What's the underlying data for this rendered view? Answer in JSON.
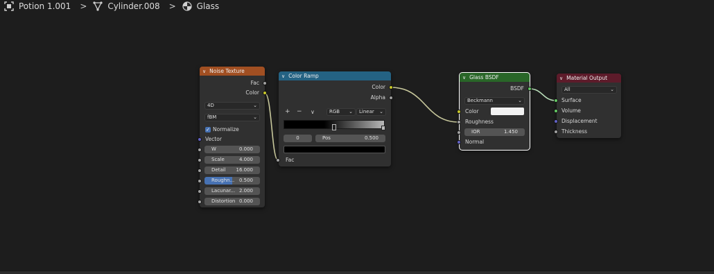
{
  "breadcrumb": {
    "items": [
      {
        "label": "Potion 1.001",
        "icon": "scene-icon"
      },
      {
        "label": "Cylinder.008",
        "icon": "mesh-icon"
      },
      {
        "label": "Glass",
        "icon": "material-icon"
      }
    ],
    "separator": ">"
  },
  "colors": {
    "noise_header": "#a14f22",
    "ramp_header": "#246283",
    "glass_header": "#296628",
    "output_header": "#5d1b2a",
    "link": "#c8c89c"
  },
  "noise_texture": {
    "title": "Noise Texture",
    "outputs": [
      "Fac",
      "Color"
    ],
    "dimensions": "4D",
    "type": "fBM",
    "normalize_label": "Normalize",
    "normalize_checked": true,
    "vector_label": "Vector",
    "fields": [
      {
        "label": "W",
        "value": "0.000"
      },
      {
        "label": "Scale",
        "value": "4.000"
      },
      {
        "label": "Detail",
        "value": "16.000"
      },
      {
        "label": "Roughn...",
        "value": "0.500"
      },
      {
        "label": "Lacunar...",
        "value": "2.000"
      },
      {
        "label": "Distortion",
        "value": "0.000"
      }
    ]
  },
  "color_ramp": {
    "title": "Color Ramp",
    "outputs": [
      "Color",
      "Alpha"
    ],
    "add": "+",
    "remove": "−",
    "menu": "∨",
    "color_mode": "RGB",
    "interpolation": "Linear",
    "index": "0",
    "pos_label": "Pos",
    "pos_value": "0.500",
    "input": "Fac"
  },
  "glass_bsdf": {
    "title": "Glass BSDF",
    "output": "BSDF",
    "distribution": "Beckmann",
    "color_label": "Color",
    "roughness_label": "Roughness",
    "ior_label": "IOR",
    "ior_value": "1.450",
    "normal_label": "Normal"
  },
  "material_output": {
    "title": "Material Output",
    "target": "All",
    "inputs": [
      "Surface",
      "Volume",
      "Displacement",
      "Thickness"
    ]
  }
}
